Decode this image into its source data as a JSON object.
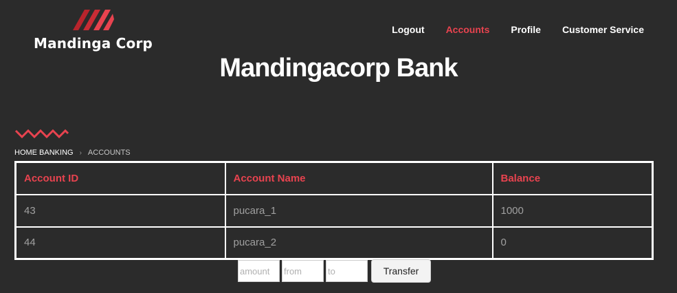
{
  "header": {
    "logo_text": "Mandinga Corp",
    "logo_icon": "brand-stripes-icon",
    "nav": [
      {
        "label": "Logout",
        "active": false
      },
      {
        "label": "Accounts",
        "active": true
      },
      {
        "label": "Profile",
        "active": false
      },
      {
        "label": "Customer Service",
        "active": false
      }
    ]
  },
  "page": {
    "title": "Mandingacorp Bank",
    "decor_icon": "zigzag-icon"
  },
  "breadcrumb": {
    "home": "HOME BANKING",
    "separator": "›",
    "current": "ACCOUNTS"
  },
  "table": {
    "headers": [
      "Account ID",
      "Account Name",
      "Balance"
    ],
    "rows": [
      [
        "43",
        "pucara_1",
        "1000"
      ],
      [
        "44",
        "pucara_2",
        "0"
      ]
    ]
  },
  "transfer": {
    "amount_placeholder": "amount",
    "from_placeholder": "from",
    "to_placeholder": "to",
    "button_label": "Transfer"
  },
  "colors": {
    "background": "#2b2b2b",
    "accent": "#e8434f",
    "accent_dark": "#b8242c",
    "text": "#ffffff",
    "muted": "#a0a0a0"
  }
}
